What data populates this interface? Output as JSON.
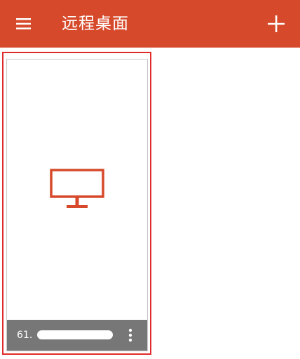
{
  "app_bar": {
    "title": "远程桌面",
    "background_color": "#d6492a",
    "menu_icon": "hamburger-menu-icon",
    "add_icon": "plus-icon"
  },
  "highlight": {
    "border_color": "#e02b2b"
  },
  "desktop_tile": {
    "icon": "monitor-icon",
    "icon_color": "#d6492a",
    "host_label": "61.",
    "host_redacted": true,
    "footer_color": "#777777",
    "more_icon": "more-vertical-icon"
  }
}
